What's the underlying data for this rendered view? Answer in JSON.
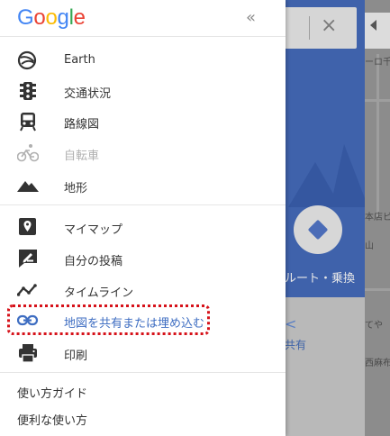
{
  "logo": {
    "text": "Google",
    "letters": [
      {
        "ch": "G",
        "color": "#4285F4"
      },
      {
        "ch": "o",
        "color": "#EA4335"
      },
      {
        "ch": "o",
        "color": "#FBBC05"
      },
      {
        "ch": "g",
        "color": "#4285F4"
      },
      {
        "ch": "l",
        "color": "#34A853"
      },
      {
        "ch": "e",
        "color": "#EA4335"
      }
    ]
  },
  "header": {
    "collapse_icon": "«"
  },
  "menu": {
    "layers": [
      {
        "label": "Earth",
        "icon": "globe-icon"
      },
      {
        "label": "交通状況",
        "icon": "traffic-light-icon"
      },
      {
        "label": "路線図",
        "icon": "train-icon"
      },
      {
        "label": "自転車",
        "icon": "bicycle-icon",
        "disabled": true
      },
      {
        "label": "地形",
        "icon": "terrain-icon"
      }
    ],
    "actions": [
      {
        "label": "マイマップ",
        "icon": "map-pin-icon"
      },
      {
        "label": "自分の投稿",
        "icon": "edit-post-icon"
      },
      {
        "label": "タイムライン",
        "icon": "timeline-icon"
      },
      {
        "label": "地図を共有または埋め込む",
        "icon": "link-icon",
        "active": true
      },
      {
        "label": "印刷",
        "icon": "printer-icon"
      }
    ],
    "links": [
      "使い方ガイド",
      "便利な使い方"
    ]
  },
  "background": {
    "close_icon": "×",
    "route_label": "ルート・乗換",
    "share_label": "共有",
    "map_labels": [
      "ーロ千",
      "本店ビ",
      "山",
      "てや",
      "西麻布"
    ]
  },
  "colors": {
    "accent": "#3f6ec2",
    "highlight": "#d6121a",
    "panel_blue": "#3f62ab"
  }
}
